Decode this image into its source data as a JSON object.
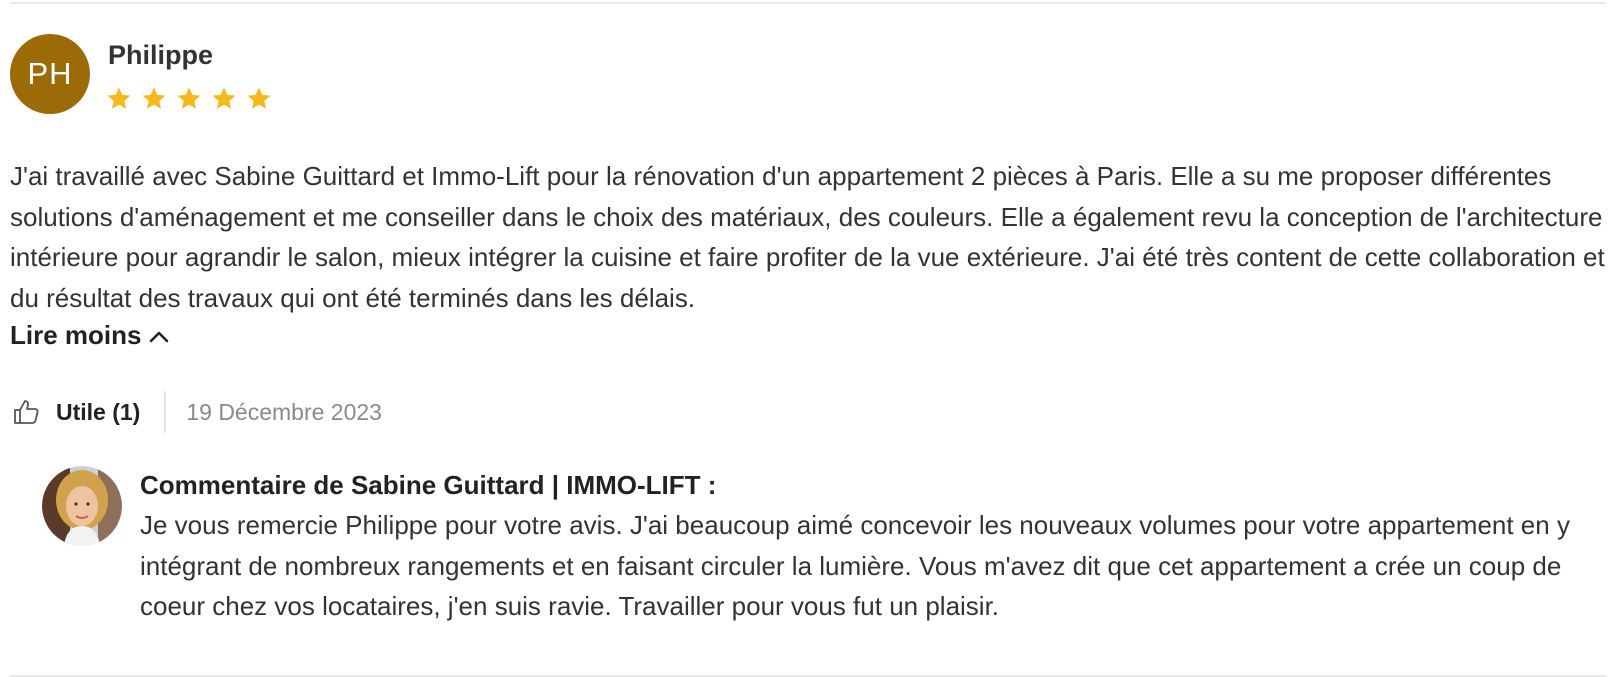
{
  "review": {
    "avatar_initials": "PH",
    "avatar_color": "#9c6a06",
    "author": "Philippe",
    "rating": 5,
    "rating_max": 5,
    "star_color": "#f6b81a",
    "text": "J'ai travaillé avec Sabine Guittard et Immo-Lift pour la rénovation d'un appartement 2 pièces à Paris. Elle a su me proposer différentes solutions d'aménagement et me conseiller dans le choix des matériaux, des couleurs. Elle a également revu la conception de l'architecture intérieure pour agrandir le salon, mieux intégrer la cuisine et faire profiter de la vue extérieure. J'ai été très content de cette collaboration et du résultat des travaux qui ont été terminés dans les délais.",
    "read_less_label": "Lire moins",
    "read_less_icon": "chevron-up-icon",
    "useful_icon": "thumbs-up-icon",
    "useful_label": "Utile (1)",
    "date": "19 Décembre 2023"
  },
  "reply": {
    "avatar_icon": "profile-photo",
    "title": "Commentaire de Sabine Guittard | IMMO-LIFT :",
    "text": "Je vous remercie Philippe pour votre avis. J'ai beaucoup aimé concevoir les nouveaux volumes pour votre appartement en y intégrant de nombreux rangements et en faisant circuler la lumière. Vous m'avez dit que cet appartement a crée un coup de coeur chez vos locataires, j'en suis ravie. Travailler pour vous fut un plaisir."
  }
}
